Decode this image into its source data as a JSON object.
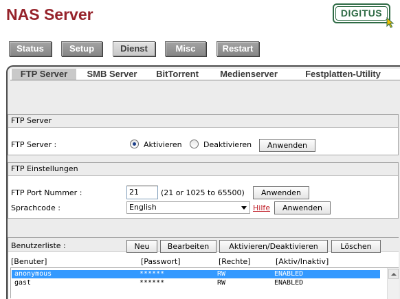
{
  "app": {
    "title": "NAS Server",
    "logo_text": "DIGITUS",
    "logo_icon": "cursor-arrow-icon"
  },
  "nav": {
    "items": [
      {
        "label": "Status"
      },
      {
        "label": "Setup"
      },
      {
        "label": "Dienst",
        "active": true
      },
      {
        "label": "Misc"
      },
      {
        "label": "Restart"
      }
    ]
  },
  "tabs": [
    {
      "label": "FTP Server",
      "active": true
    },
    {
      "label": "SMB Server"
    },
    {
      "label": "BitTorrent"
    },
    {
      "label": "Medienserver"
    },
    {
      "label": "Festplatten-Utility"
    }
  ],
  "ftp_server": {
    "header": "FTP Server",
    "label": "FTP Server :",
    "option_enable": "Aktivieren",
    "option_disable": "Deaktivieren",
    "selected": "Aktivieren",
    "apply": "Anwenden"
  },
  "ftp_settings": {
    "header": "FTP Einstellungen",
    "port_label": "FTP Port Nummer :",
    "port_value": "21",
    "port_hint": "(21 or 1025 to 65500)",
    "port_apply": "Anwenden",
    "lang_label": "Sprachcode :",
    "lang_value": "English",
    "help": "Hilfe",
    "lang_apply": "Anwenden"
  },
  "users": {
    "label": "Benutzerliste :",
    "buttons": {
      "new": "Neu",
      "edit": "Bearbeiten",
      "toggle": "Aktivieren/Deaktivieren",
      "delete": "Löschen"
    },
    "columns": [
      "[Benuter]",
      "[Passwort]",
      "[Rechte]",
      "[Aktiv/Inaktiv]"
    ],
    "rows": [
      {
        "user": "anonymous",
        "password": "******",
        "rights": "RW",
        "status": "ENABLED",
        "selected": true
      },
      {
        "user": "gast",
        "password": "******",
        "rights": "RW",
        "status": "ENABLED",
        "selected": false
      }
    ]
  },
  "colors": {
    "title": "#96232b",
    "logo": "#2f6b45",
    "selection": "#3399ff",
    "link": "#c0202a"
  }
}
